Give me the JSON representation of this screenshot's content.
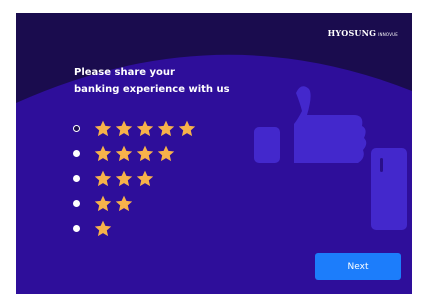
{
  "brand": {
    "name": "HYOSUNG",
    "sub": "INNOVUE"
  },
  "prompt": {
    "line1": "Please share your",
    "line2": "banking experience with us"
  },
  "rating": {
    "options": [
      {
        "stars": 5,
        "selected": true
      },
      {
        "stars": 4,
        "selected": false
      },
      {
        "stars": 3,
        "selected": false
      },
      {
        "stars": 2,
        "selected": false
      },
      {
        "stars": 1,
        "selected": false
      }
    ]
  },
  "next_button": {
    "label": "Next"
  },
  "colors": {
    "background": "#1a0c4e",
    "panel": "#2e0e9a",
    "star": "#f7b24a",
    "accent": "#1c7dfb",
    "thumb": "#4328cc"
  },
  "icons": {
    "thumb": "thumbs-up-icon",
    "star": "star-icon"
  }
}
